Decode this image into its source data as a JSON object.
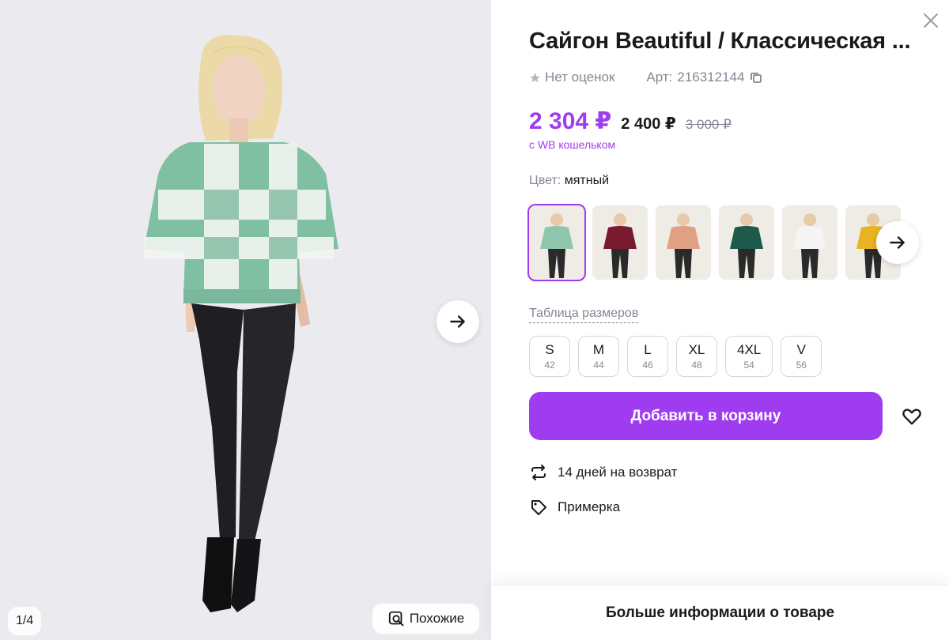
{
  "gallery": {
    "counter": "1/4",
    "similar_label": "Похожие",
    "icons": {
      "next": "arrow-right-icon",
      "similar": "search-similar-icon"
    }
  },
  "product": {
    "title": "Сайгон Beautiful / Классическая ...",
    "rating_text": "Нет оценок",
    "article_label": "Арт:",
    "article_value": "216312144",
    "price_main": "2 304 ₽",
    "price_card": "2 400 ₽",
    "price_old": "3 000 ₽",
    "wallet_note": "с WB кошельком",
    "color_label": "Цвет:",
    "color_value": "мятный",
    "swatches": [
      {
        "name": "mint",
        "top": "#8fc7ad",
        "bottom": "#2a2a2a",
        "selected": true
      },
      {
        "name": "burgundy",
        "top": "#7a1a2e",
        "bottom": "#2a2a2a",
        "selected": false
      },
      {
        "name": "peach",
        "top": "#e0a084",
        "bottom": "#2a2a2a",
        "selected": false
      },
      {
        "name": "emerald",
        "top": "#1d5a4c",
        "bottom": "#2a2a2a",
        "selected": false
      },
      {
        "name": "white",
        "top": "#f4f4f4",
        "bottom": "#2a2a2a",
        "selected": false
      },
      {
        "name": "yellow",
        "top": "#e7b320",
        "bottom": "#2a2a2a",
        "selected": false
      }
    ],
    "size_table_link": "Таблица размеров",
    "sizes": [
      {
        "label": "S",
        "ru": "42"
      },
      {
        "label": "M",
        "ru": "44"
      },
      {
        "label": "L",
        "ru": "46"
      },
      {
        "label": "XL",
        "ru": "48"
      },
      {
        "label": "4XL",
        "ru": "54"
      },
      {
        "label": "V",
        "ru": "56"
      }
    ],
    "add_to_cart": "Добавить в корзину",
    "features": [
      {
        "icon": "return-arrows-icon",
        "text": "14 дней на возврат"
      },
      {
        "icon": "tag-icon",
        "text": "Примерка"
      }
    ],
    "more_info": "Больше информации о товаре"
  },
  "colors": {
    "accent": "#a03cf0",
    "muted": "#868695",
    "text": "#1a1a1a"
  }
}
